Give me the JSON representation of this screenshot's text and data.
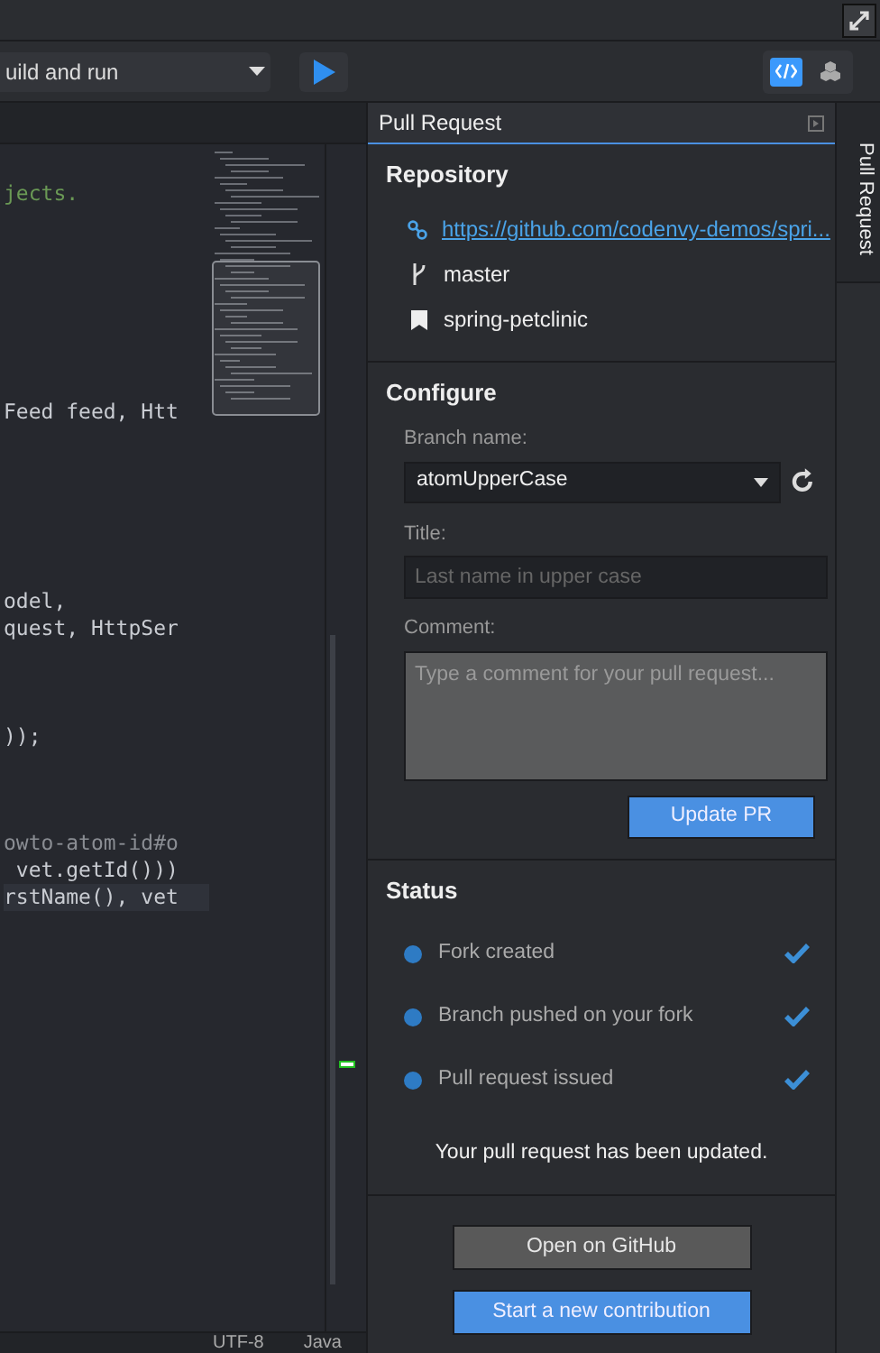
{
  "toolbar": {
    "run_config": "uild and run",
    "views": [
      {
        "kind": "code",
        "selected": true
      },
      {
        "kind": "cubes",
        "selected": false
      }
    ]
  },
  "editor": {
    "code_groups": [
      {
        "lines": [
          {
            "text": "jects.",
            "kind": "comment"
          }
        ]
      },
      {
        "lines": [
          {
            "text": "Feed feed, Htt",
            "kind": "code"
          }
        ]
      },
      {
        "lines": [
          {
            "text": "odel,",
            "kind": "code"
          },
          {
            "text": "quest, HttpSer",
            "kind": "code"
          }
        ]
      },
      {
        "lines": [
          {
            "text": "));",
            "kind": "code"
          }
        ]
      },
      {
        "lines": [
          {
            "text": "owto-atom-id#o",
            "kind": "string"
          },
          {
            "text": " vet.getId()))",
            "kind": "code"
          },
          {
            "text": "rstName(), vet",
            "kind": "code",
            "selected": true
          }
        ]
      }
    ]
  },
  "status_bar": {
    "encoding": "UTF-8",
    "language": "Java"
  },
  "panel": {
    "title": "Pull Request",
    "repository": {
      "heading": "Repository",
      "url": "https://github.com/codenvy-demos/spri...",
      "branch": "master",
      "project": "spring-petclinic"
    },
    "configure": {
      "heading": "Configure",
      "branch_label": "Branch name:",
      "branch_value": "atomUpperCase",
      "title_label": "Title:",
      "title_placeholder": "Last name in upper case",
      "comment_label": "Comment:",
      "comment_placeholder": "Type a comment for your pull request...",
      "update_button": "Update PR"
    },
    "status": {
      "heading": "Status",
      "steps": [
        {
          "label": "Fork created",
          "checked": true
        },
        {
          "label": "Branch pushed on your fork",
          "checked": true
        },
        {
          "label": "Pull request issued",
          "checked": true
        }
      ],
      "message": "Your pull request has been updated."
    },
    "buttons": [
      {
        "label": "Open on GitHub",
        "kind": "secondary"
      },
      {
        "label": "Start a new contribution",
        "kind": "primary"
      }
    ]
  },
  "side_tabs": [
    {
      "label": "Pull Request",
      "selected": true
    }
  ]
}
